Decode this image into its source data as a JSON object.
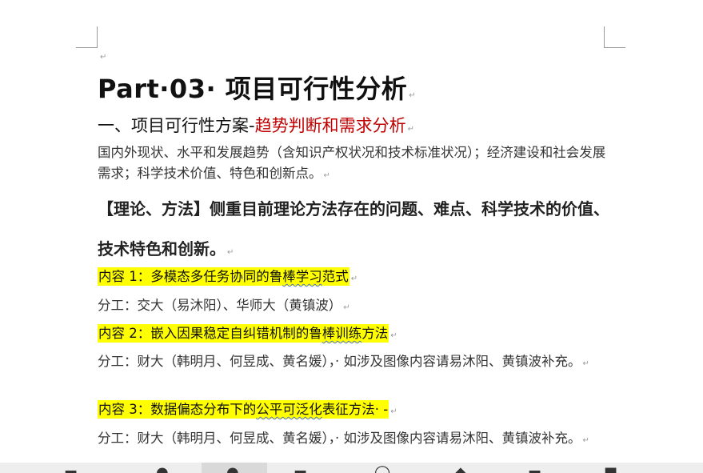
{
  "marks": {
    "paragraph": "↵"
  },
  "title": "Part·03· 项目可行性分析",
  "subtitle": {
    "main": "一、项目可行性方案-",
    "highlight": "趋势判断和需求分析",
    "color": "#c00000"
  },
  "intro": "国内外现状、水平和发展趋势（含知识产权状况和技术标准状况）；经济建设和社会发展需求；科学技术价值、特色和创新点。",
  "theory": "【理论、方法】侧重目前理论方法存在的问题、难点、科学技术的价值、技术特色和创新。",
  "items": [
    {
      "content_pre": "内容 1：多模态多任务协同的鲁",
      "content_wavy": "棒学习",
      "content_post": "范式",
      "division": "分工：交大（易沐阳）、华师大（黄镇波）"
    },
    {
      "content_pre": "内容 2：嵌入因果稳定自纠错机制的鲁",
      "content_wavy": "棒训练",
      "content_post": "方法",
      "division": "分工：财大（韩明月、何昱成、黄名媛），· 如涉及图像内容请易沐阳、黄镇波补充。"
    },
    {
      "content_pre": "内容 3：数据偏态分布下的",
      "content_wavy": "公平可泛化",
      "content_post": "表征方法· -",
      "division": "分工：财大（韩明月、何昱成、黄名媛），· 如涉及图像内容请易沐阳、黄镇波补充。"
    }
  ],
  "colors": {
    "highlight": "#ffff00",
    "accent_red": "#c00000"
  }
}
